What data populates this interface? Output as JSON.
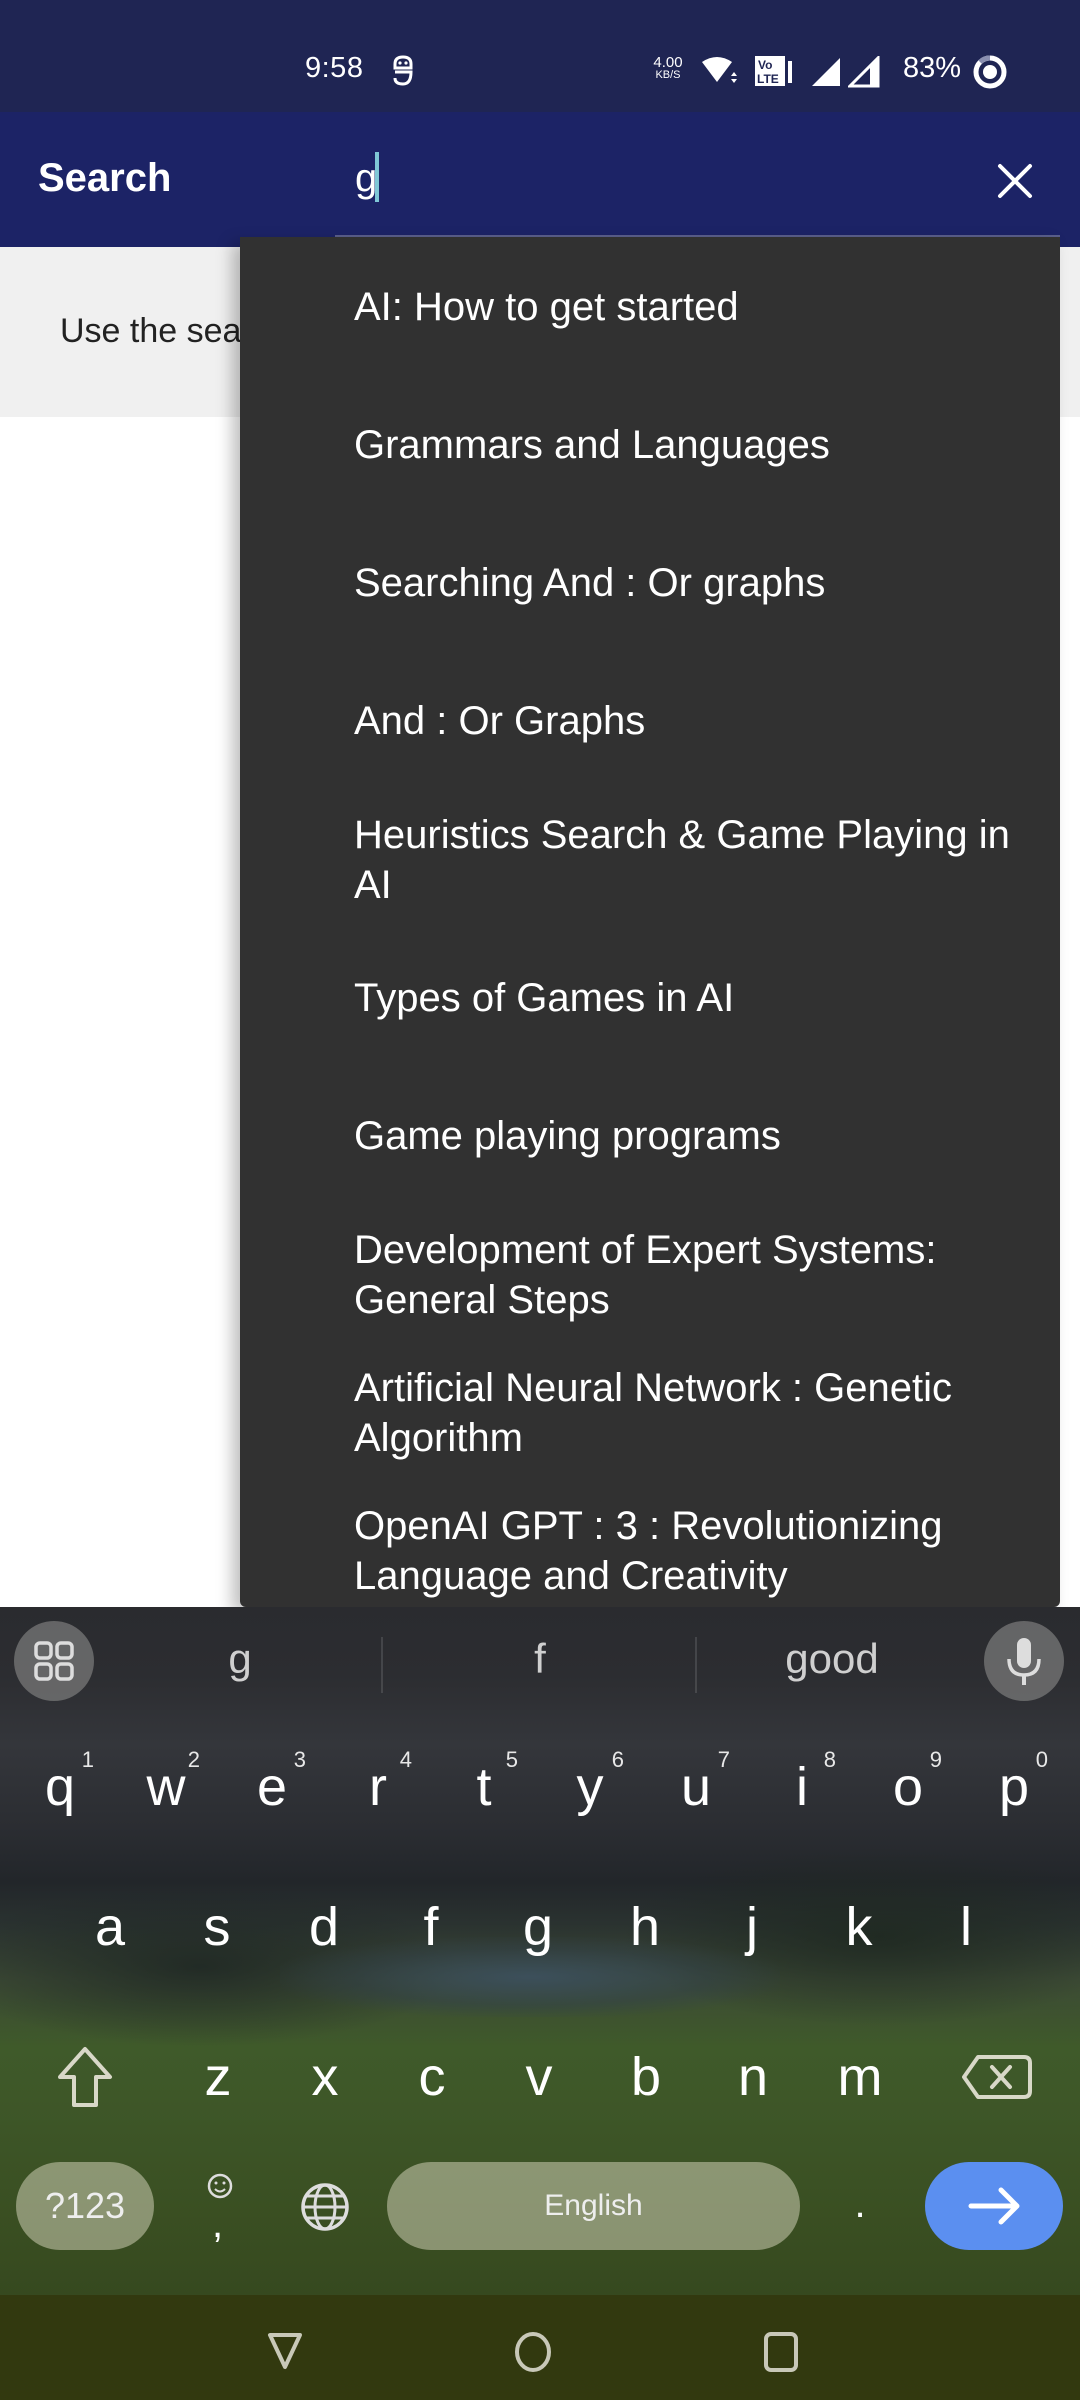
{
  "status_bar": {
    "time": "9:58",
    "net_speed_value": "4.00",
    "net_speed_unit": "KB/S",
    "battery": "83%",
    "icons": [
      "notification-app-icon",
      "wifi-icon",
      "volte-icon",
      "signal-1-icon",
      "signal-2-icon",
      "battery-icon"
    ]
  },
  "app_bar": {
    "title": "Search",
    "search_value": "g",
    "close_icon": "close-icon"
  },
  "hint": {
    "text": "Use the search bar above to find topics"
  },
  "suggestions": [
    "AI: How to get started",
    "Grammars and Languages",
    "Searching And : Or graphs",
    "And : Or Graphs",
    "Heuristics Search & Game Playing in AI",
    "Types of Games in AI",
    "Game playing programs",
    "Development of Expert Systems: General Steps",
    "Artificial Neural Network  :  Genetic Algorithm",
    "OpenAI GPT : 3  : Revolutionizing Language and Creativity"
  ],
  "keyboard": {
    "word_suggestions": [
      "g",
      "f",
      "good"
    ],
    "row1": [
      {
        "key": "q",
        "hint": "1"
      },
      {
        "key": "w",
        "hint": "2"
      },
      {
        "key": "e",
        "hint": "3"
      },
      {
        "key": "r",
        "hint": "4"
      },
      {
        "key": "t",
        "hint": "5"
      },
      {
        "key": "y",
        "hint": "6"
      },
      {
        "key": "u",
        "hint": "7"
      },
      {
        "key": "i",
        "hint": "8"
      },
      {
        "key": "o",
        "hint": "9"
      },
      {
        "key": "p",
        "hint": "0"
      }
    ],
    "row2": [
      "a",
      "s",
      "d",
      "f",
      "g",
      "h",
      "j",
      "k",
      "l"
    ],
    "row3": [
      "z",
      "x",
      "c",
      "v",
      "b",
      "n",
      "m"
    ],
    "symbols_label": "?123",
    "comma": ",",
    "space_label": "English",
    "period": ".",
    "accent_color": "#5b8ff0"
  },
  "nav_bar": {
    "buttons": [
      "back",
      "home",
      "recents"
    ]
  }
}
